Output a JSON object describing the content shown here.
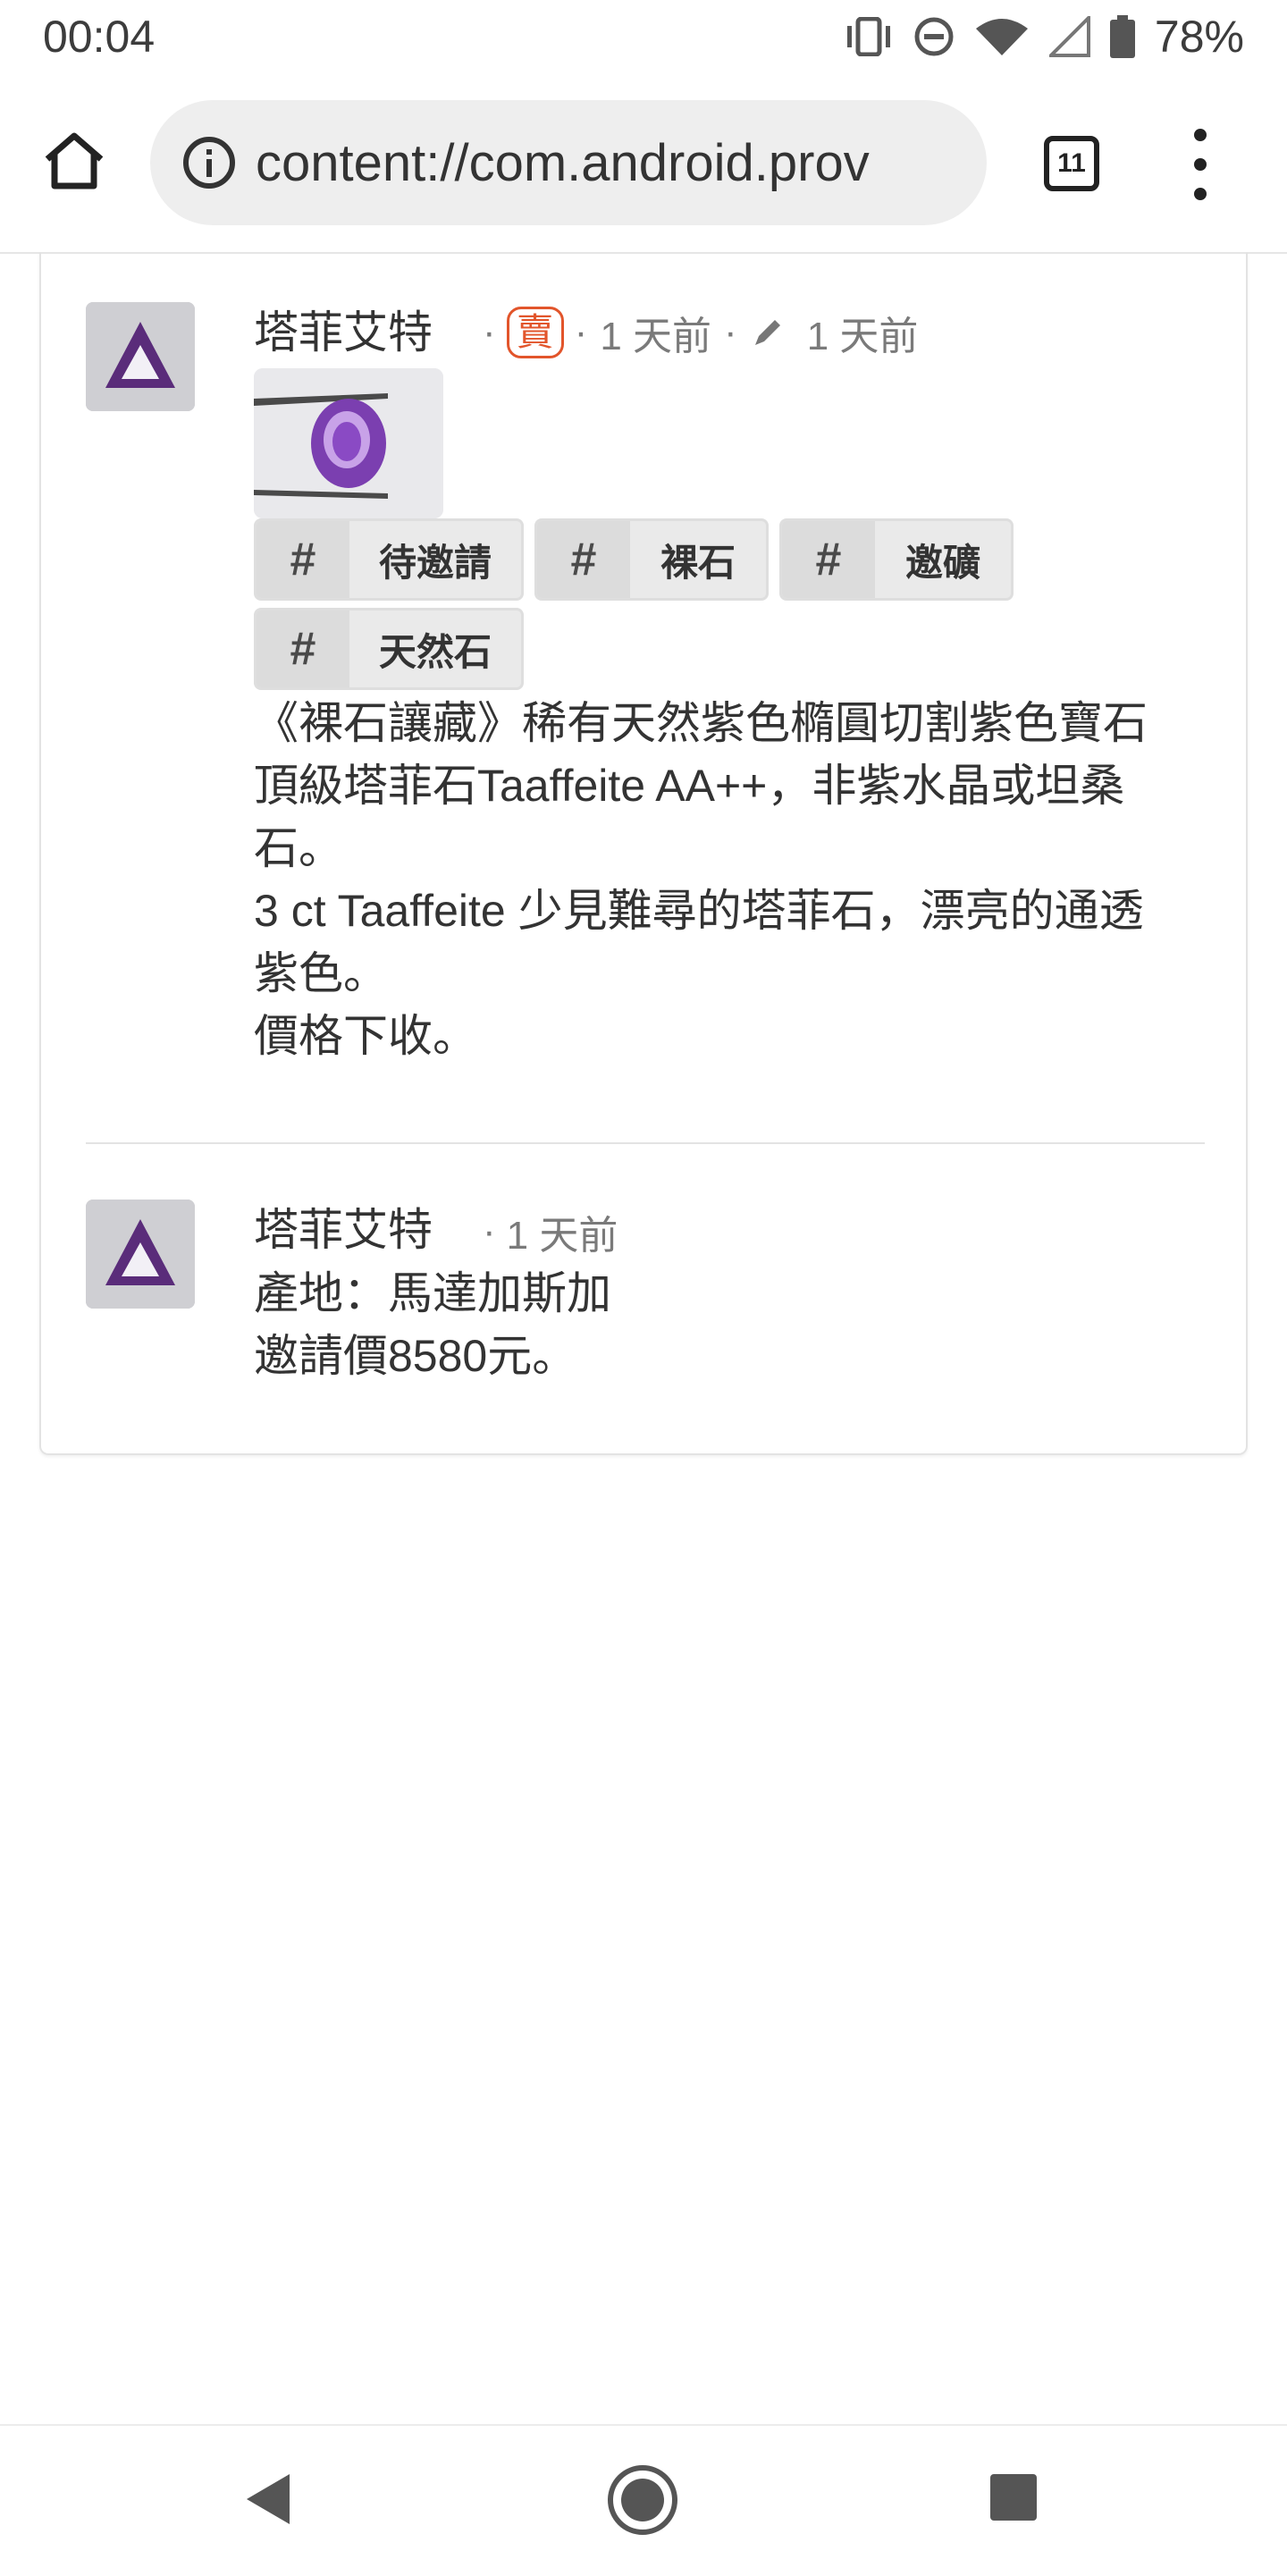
{
  "status_bar": {
    "time": "00:04",
    "battery": "78%",
    "icons": [
      "vibrate-icon",
      "do-not-disturb-icon",
      "wifi-icon",
      "signal-icon",
      "battery-icon"
    ]
  },
  "browser": {
    "url": "content://com.android.prov",
    "tab_count": "11"
  },
  "post": {
    "author": "塔菲艾特",
    "badge": "賣",
    "posted": "1 天前",
    "edited": "1 天前",
    "tags": [
      "待邀請",
      "裸石",
      "邀礦",
      "天然石"
    ],
    "body_lines": [
      "《裸石讓藏》稀有天然紫色橢圓切割紫色寶石",
      "頂級塔菲石Taaffeite AA++，非紫水晶或坦桑",
      "石。",
      "3 ct Taaffeite 少見難尋的塔菲石，漂亮的通透",
      "紫色。",
      "價格下收。"
    ]
  },
  "comment": {
    "author": "塔菲艾特",
    "posted": "1 天前",
    "body_lines": [
      "產地：馬達加斯加",
      "邀請價8580元。"
    ]
  },
  "colors": {
    "badge": "#e2552b",
    "gem": "#6a2f8f"
  }
}
